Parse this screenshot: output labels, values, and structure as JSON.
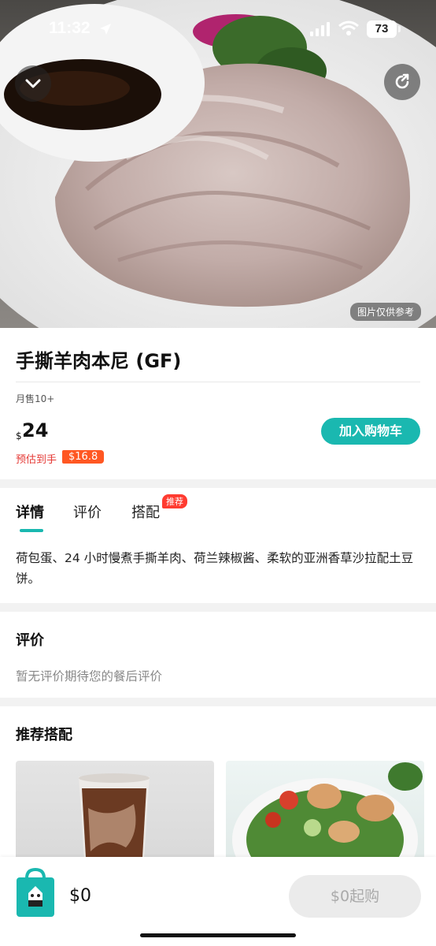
{
  "status_bar": {
    "time": "11:32",
    "battery": "73"
  },
  "hero": {
    "reference_label": "图片仅供参考"
  },
  "product": {
    "title": "手撕羊肉本尼 (GF)",
    "monthly_sales": "月售10+",
    "currency": "$",
    "price": "24",
    "estimate_label": "预估到手",
    "estimate_price": "$16.8",
    "add_to_cart": "加入购物车"
  },
  "tabs": [
    {
      "label": "详情",
      "active": true
    },
    {
      "label": "评价",
      "active": false
    },
    {
      "label": "搭配",
      "active": false,
      "badge": "推荐"
    }
  ],
  "description": "荷包蛋、24 小时慢煮手撕羊肉、荷兰辣椒酱、柔软的亚洲香草沙拉配土豆饼。",
  "reviews": {
    "title": "评价",
    "empty_text": "暂无评价期待您的餐后评价"
  },
  "recommended": {
    "title": "推荐搭配"
  },
  "bottom_bar": {
    "cart_total": "$0",
    "min_order_button": "$0起购"
  },
  "colors": {
    "accent": "#1ab8b0",
    "estimate_red": "#e53935",
    "badge_orange": "#ff5722",
    "badge_red": "#ff3b30"
  }
}
